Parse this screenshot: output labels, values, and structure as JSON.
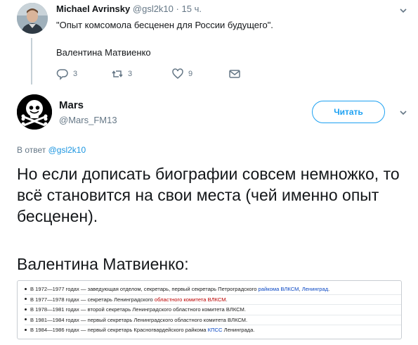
{
  "parent_tweet": {
    "name": "Michael Avrinsky",
    "handle": "@gsl2k10",
    "separator": "·",
    "time": "15 ч.",
    "text": "\"Опыт комсомола бесценен для России будущего\".",
    "text_line2": "Валентина Матвиенко",
    "actions": {
      "reply_count": "3",
      "retweet_count": "3",
      "like_count": "9"
    }
  },
  "reply_tweet": {
    "name": "Mars",
    "handle": "@Mars_FM13",
    "follow_label": "Читать",
    "reply_prefix": "В ответ",
    "reply_mention": "@gsl2k10",
    "text": "Но если дописать биографии совсем немножко, то всё становится на свои места (чей именно опыт бесценен).",
    "text_name": "Валентина Матвиенко:"
  },
  "embedded_image": {
    "rows": [
      {
        "pre": "В 1972—1977 годах — заведующая отделом, секретарь, первый секретарь Петроградского ",
        "link": "райкома ВЛКСМ",
        "mid": ", ",
        "link2": "Ленинград",
        "post": "."
      },
      {
        "pre": "В 1977—1978 годах — секретарь Ленинградского ",
        "redlink": "областного комитета ВЛКСМ",
        "post": "."
      },
      {
        "pre": "В 1978—1981 годах — второй секретарь Ленинградского областного комитета ВЛКСМ.",
        "post": ""
      },
      {
        "pre": "В 1981—1984 годах — первый секретарь Ленинградского областного комитета ВЛКСМ.",
        "post": ""
      },
      {
        "pre": "В 1984—1986 годах — первый секретарь Красногвардейского райкома ",
        "link": "КПСС",
        "post": " Ленинграда."
      }
    ]
  },
  "colors": {
    "twitter_blue": "#1da1f2",
    "secondary_text": "#657786",
    "primary_text": "#14171a",
    "wiki_link": "#0b48c4",
    "wiki_redlink": "#ba0000"
  },
  "icons": [
    "reply-icon",
    "retweet-icon",
    "like-icon",
    "dm-icon",
    "chevron-down-icon"
  ]
}
